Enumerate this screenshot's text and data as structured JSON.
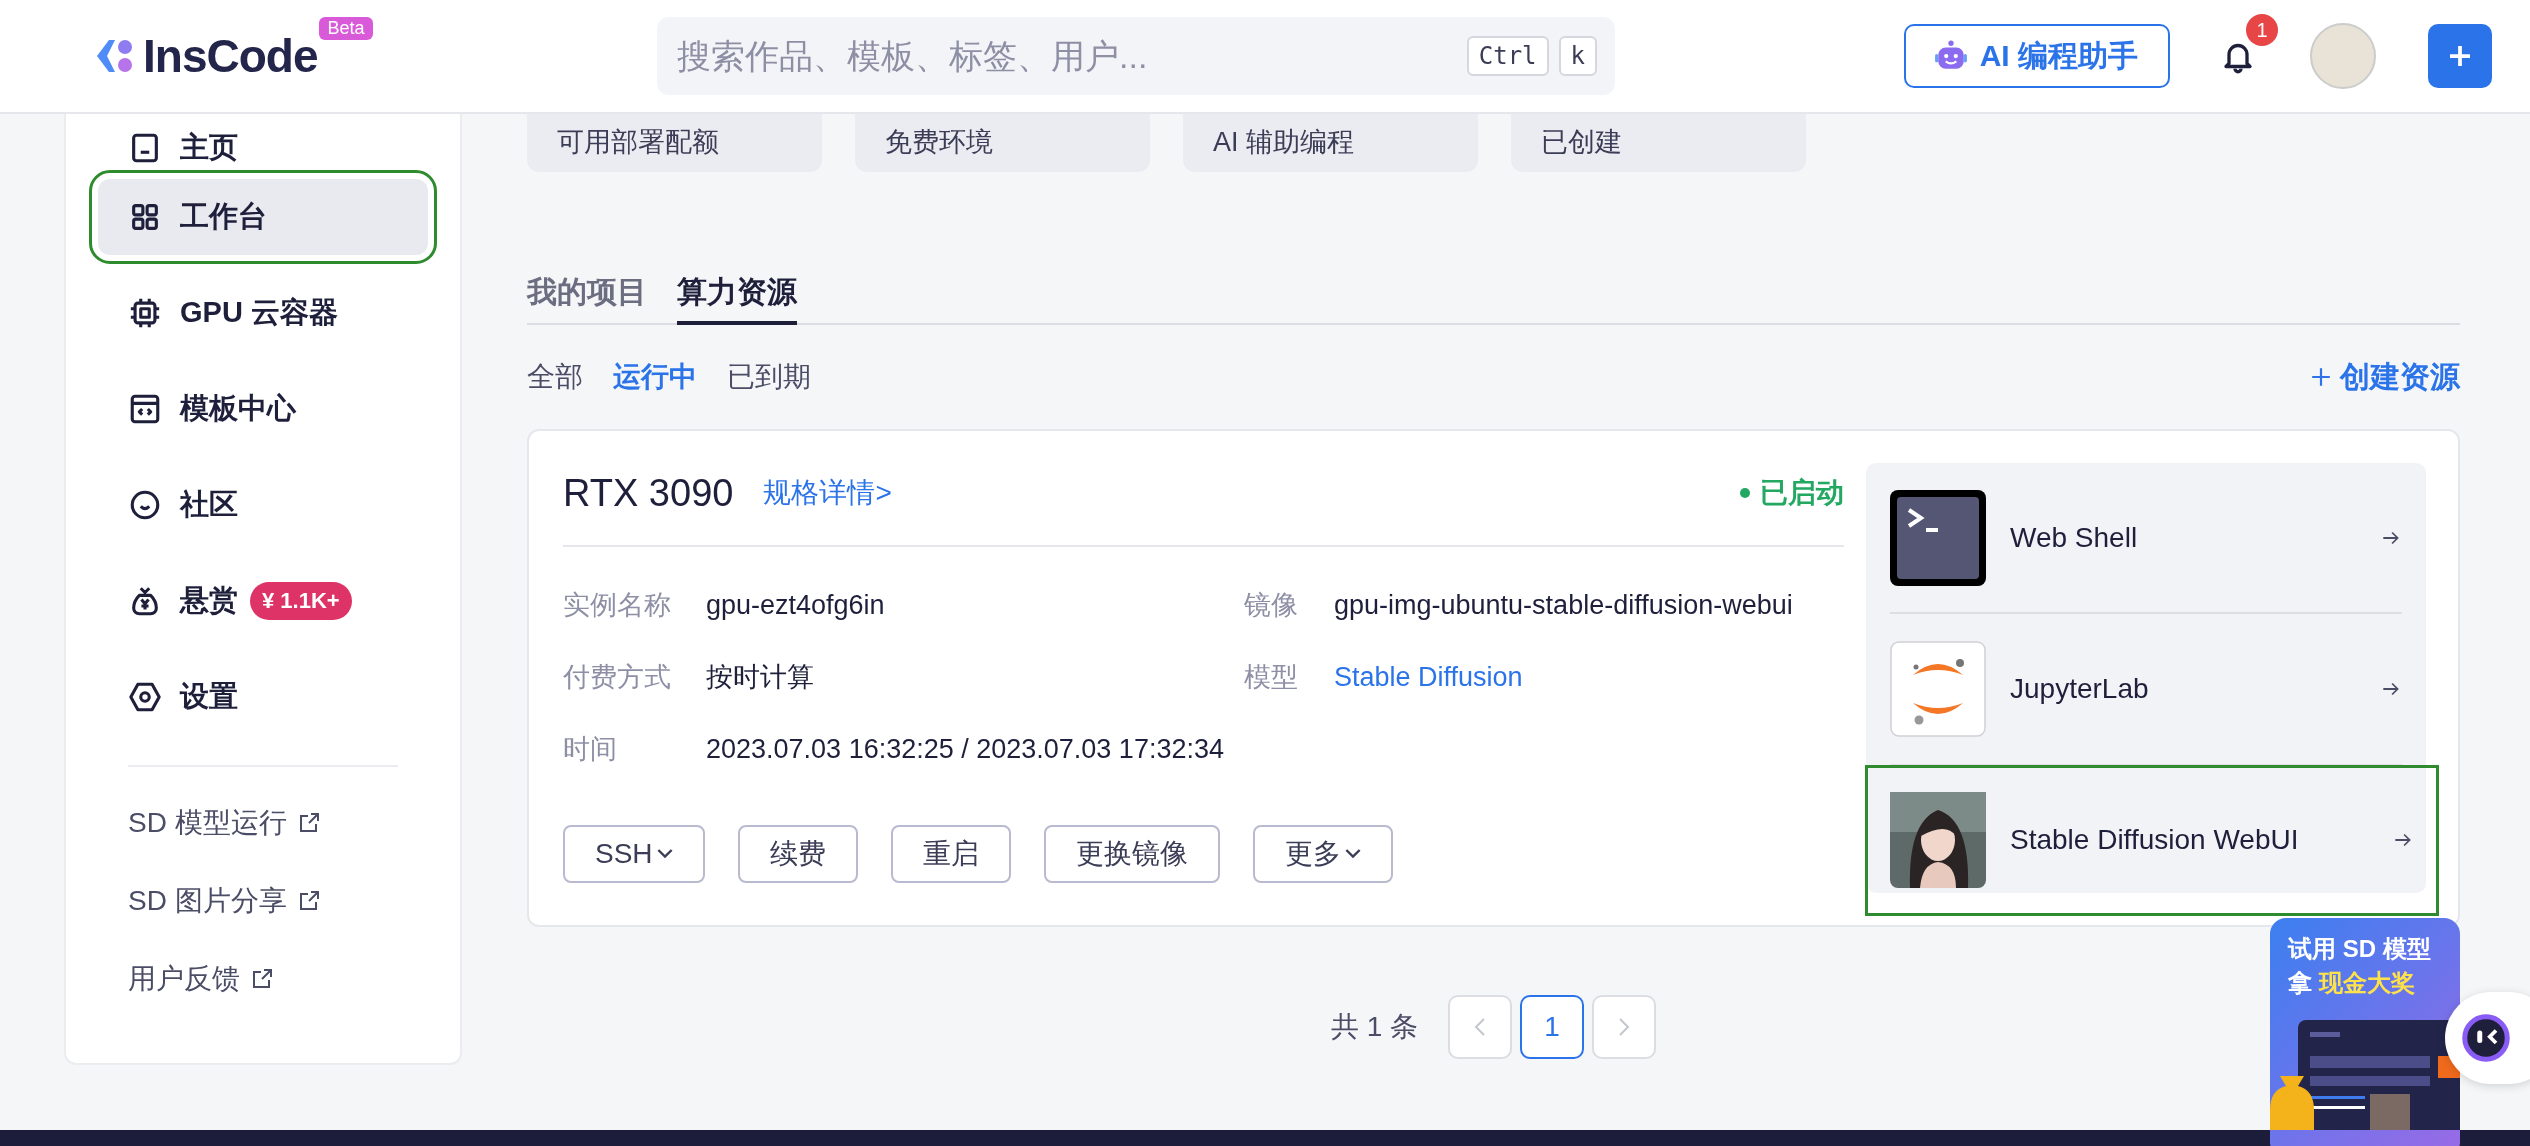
{
  "header": {
    "logo": "InsCode",
    "logo_badge": "Beta",
    "search": {
      "placeholder": "搜索作品、模板、标签、用户...",
      "keys": [
        "Ctrl",
        "k"
      ]
    },
    "ai_button": "AI 编程助手",
    "notification_count": "1"
  },
  "sidebar": {
    "items": [
      {
        "label": "主页",
        "selected": false,
        "highlighted": false
      },
      {
        "label": "工作台",
        "selected": true,
        "highlighted": true
      },
      {
        "label": "GPU 云容器",
        "selected": false,
        "highlighted": false
      },
      {
        "label": "模板中心",
        "selected": false,
        "highlighted": false
      },
      {
        "label": "社区",
        "selected": false,
        "highlighted": false
      },
      {
        "label": "悬赏",
        "selected": false,
        "highlighted": false,
        "badge": "¥ 1.1K+"
      },
      {
        "label": "设置",
        "selected": false,
        "highlighted": false
      }
    ],
    "links": [
      "SD 模型运行",
      "SD 图片分享",
      "用户反馈"
    ]
  },
  "stat_cards": [
    "可用部署配额",
    "免费环境",
    "AI 辅助编程",
    "已创建"
  ],
  "tabs": [
    {
      "label": "我的项目",
      "selected": false
    },
    {
      "label": "算力资源",
      "selected": true
    }
  ],
  "filters": [
    {
      "label": "全部",
      "selected": false
    },
    {
      "label": "运行中",
      "selected": true
    },
    {
      "label": "已到期",
      "selected": false
    }
  ],
  "create_button": "创建资源",
  "resource_card": {
    "title": "RTX 3090",
    "spec_link": "规格详情>",
    "status": {
      "label": "已启动",
      "running": true
    },
    "fields": [
      {
        "label": "实例名称",
        "value": "gpu-ezt4ofg6in",
        "kind": "text"
      },
      {
        "label": "镜像",
        "value": "gpu-img-ubuntu-stable-diffusion-webui",
        "kind": "text"
      },
      {
        "label": "付费方式",
        "value": "按时计算",
        "kind": "text"
      },
      {
        "label": "模型",
        "value": "Stable Diffusion",
        "kind": "link"
      },
      {
        "label": "时间",
        "value": "2023.07.03 16:32:25 / 2023.07.03 17:32:34",
        "kind": "text"
      }
    ],
    "actions": [
      {
        "label": "SSH",
        "dropdown": true
      },
      {
        "label": "续费",
        "dropdown": false
      },
      {
        "label": "重启",
        "dropdown": false
      },
      {
        "label": "更换镜像",
        "dropdown": false
      },
      {
        "label": "更多",
        "dropdown": true
      }
    ],
    "apps": [
      {
        "name": "Web Shell",
        "highlighted": false
      },
      {
        "name": "JupyterLab",
        "highlighted": false
      },
      {
        "name": "Stable Diffusion WebUI",
        "highlighted": true
      }
    ]
  },
  "pagination": {
    "summary": "共 1 条",
    "pages": [
      {
        "label": "1",
        "selected": true
      }
    ]
  },
  "promo": {
    "line_1": "试用 SD 模型",
    "line_2": "拿",
    "line_2_highlight": "现金大奖"
  }
}
